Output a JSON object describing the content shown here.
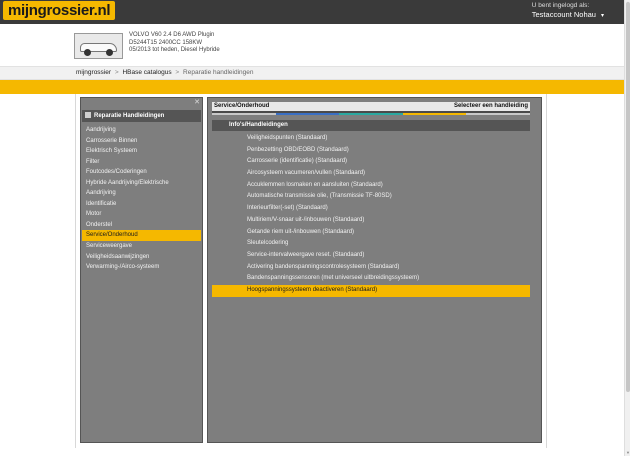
{
  "header": {
    "logo": "mijngrossier.nl",
    "login_line1": "U bent ingelogd als:",
    "login_name": "Testaccount Nohau",
    "login_caret": "▾"
  },
  "vehicle": {
    "line1": "VOLVO V60 2.4 D6 AWD Plugin",
    "line2": "D5244T15 2400CC 158KW",
    "line3": "05/2013 tot heden, Diesel Hybride"
  },
  "breadcrumb": {
    "item1": "mijngrossier",
    "sep": ">",
    "item2": "HBase catalogus",
    "item3": "Reparatie handleidingen"
  },
  "left_panel": {
    "close": "✕",
    "title": "Reparatie Handleidingen",
    "items": [
      {
        "label": "Aandrijving"
      },
      {
        "label": "Carrosserie Binnen"
      },
      {
        "label": "Elektrisch Systeem"
      },
      {
        "label": "Filter"
      },
      {
        "label": "Foutcodes/Coderingen"
      },
      {
        "label": "Hybride Aandrijving/Elektrische"
      },
      {
        "label": "Aandrijving"
      },
      {
        "label": "Identificatie"
      },
      {
        "label": "Motor"
      },
      {
        "label": "Onderstel"
      },
      {
        "label": "Service/Onderhoud"
      },
      {
        "label": "Serviceweergave"
      },
      {
        "label": "Veiligheidsaanwijzingen"
      },
      {
        "label": "Verwarming-/Airco-systeem"
      }
    ],
    "active_index": 10
  },
  "right_panel": {
    "title": "Service/Onderhoud",
    "select_label": "Selecteer een handleiding",
    "color_bar": [
      "#c8c8c8",
      "#3a6fc4",
      "#2aa8a0",
      "#f5b800",
      "#c8c8c8"
    ],
    "subheader": "Info's/Handleidingen",
    "items": [
      {
        "label": "Veiligheidspunten (Standaard)"
      },
      {
        "label": "Penbezetting OBD/EOBD (Standaard)"
      },
      {
        "label": "Carrosserie (identificatie) (Standaard)"
      },
      {
        "label": "Aircosysteem vacumeren/vullen (Standaard)"
      },
      {
        "label": "Accuklemmen losmaken en aansluiten (Standaard)"
      },
      {
        "label": "Automatische transmissie olie, (Transmissie TF-80SD)"
      },
      {
        "label": "Interieurfilter(-set) (Standaard)"
      },
      {
        "label": "Multiriem/V-snaar uit-/inbouwen (Standaard)"
      },
      {
        "label": "Getande riem uit-/inbouwen (Standaard)"
      },
      {
        "label": "Sleutelcodering"
      },
      {
        "label": "Service-intervalweergave reset. (Standaard)"
      },
      {
        "label": "Activering bandenspanningscontrolesysteem (Standaard)"
      },
      {
        "label": "Bandenspanningssensoren (met universeel uitbreidingssysteem)"
      },
      {
        "label": "Hoogspanningssysteem deactiveren (Standaard)"
      }
    ],
    "active_index": 13
  },
  "colors": {
    "accent": "#f5b800",
    "topbar": "#3a3a3a",
    "panel": "#7e7e7e"
  }
}
